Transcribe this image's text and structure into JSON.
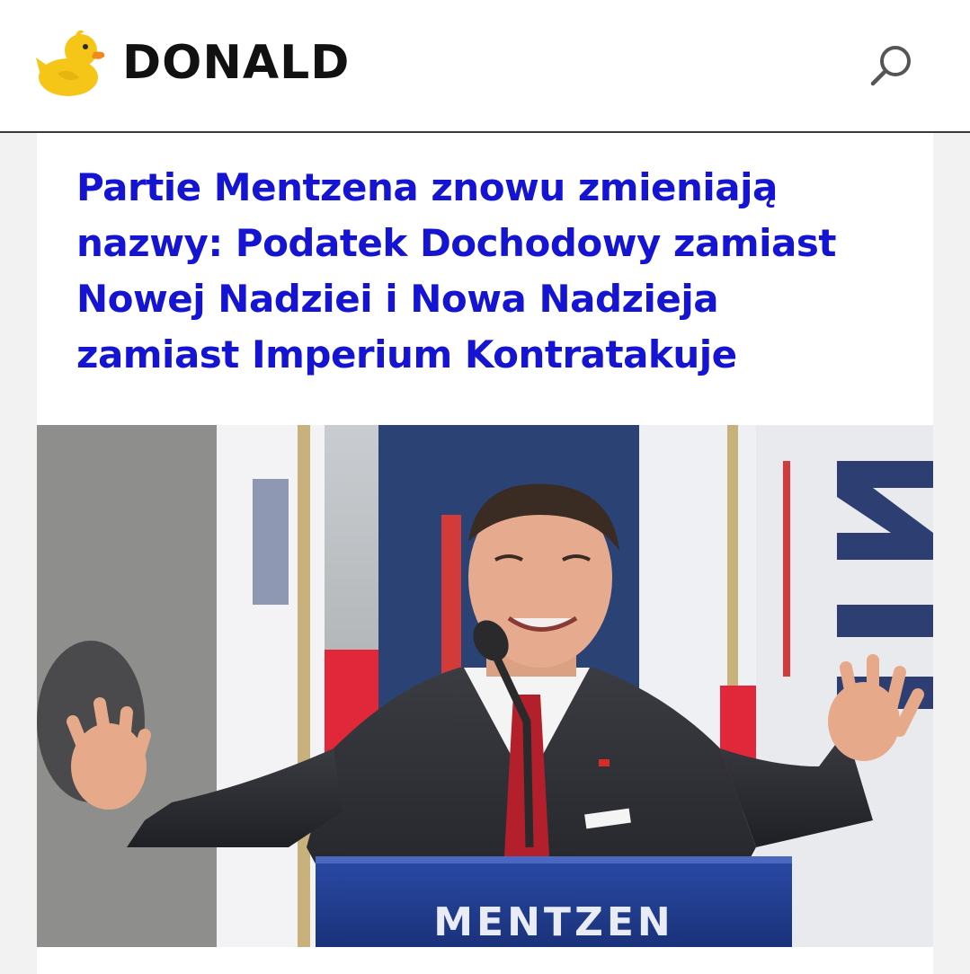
{
  "header": {
    "brand": "DONALD",
    "logo_icon": "duck-icon",
    "search_icon": "search-icon"
  },
  "article": {
    "headline": "Partie Mentzena znowu zmieniają nazwy: Podatek Dochodowy zamiast Nowej Nadziei i Nowa Nadzieja zamiast Imperium Kontratakuje",
    "image": {
      "podium_text": "MENTZEN"
    }
  },
  "colors": {
    "headline": "#1414d2",
    "podium": "#1f3d8f",
    "duck": "#f5c518"
  }
}
